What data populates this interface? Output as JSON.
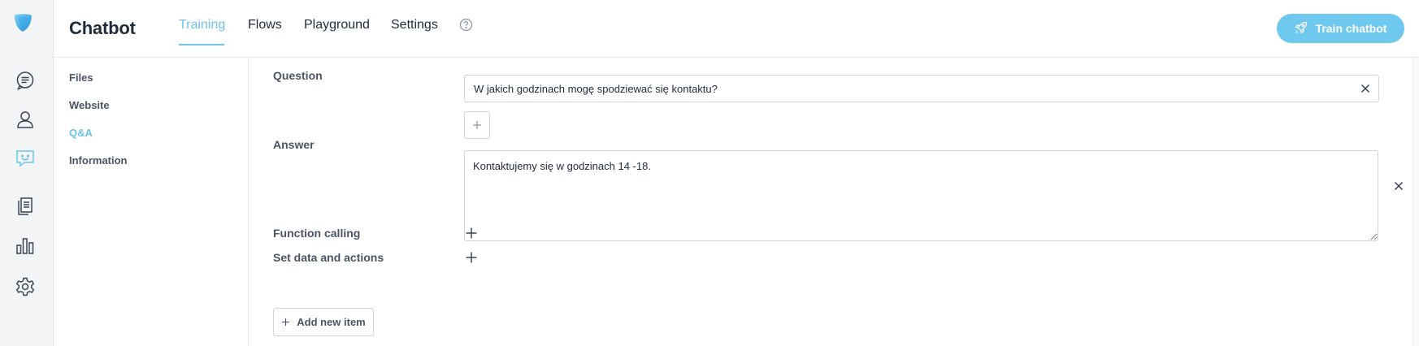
{
  "app": {
    "title": "Chatbot"
  },
  "tabs": [
    {
      "label": "Training",
      "active": true
    },
    {
      "label": "Flows"
    },
    {
      "label": "Playground"
    },
    {
      "label": "Settings"
    }
  ],
  "header": {
    "train_button_label": "Train chatbot"
  },
  "rail_icons": [
    "chat-bubble-icon",
    "user-icon",
    "chatbot-icon",
    "documents-icon",
    "bar-chart-icon",
    "gear-icon"
  ],
  "subnav": [
    {
      "label": "Files"
    },
    {
      "label": "Website"
    },
    {
      "label": "Q&A",
      "active": true
    },
    {
      "label": "Information"
    }
  ],
  "form": {
    "question_label": "Question",
    "question_value": "W jakich godzinach mogę spodziewać się kontaktu?",
    "answer_label": "Answer",
    "answer_value": "Kontaktujemy się w godzinach 14 -18.",
    "function_calling_label": "Function calling",
    "set_data_label": "Set data and actions",
    "add_new_item_label": "Add new item"
  },
  "colors": {
    "accent": "#6bc5ea",
    "button": "#6fc8ee",
    "text": "#1f2a3a",
    "muted": "#4a5566",
    "rail_bg": "#f3f4f6"
  }
}
